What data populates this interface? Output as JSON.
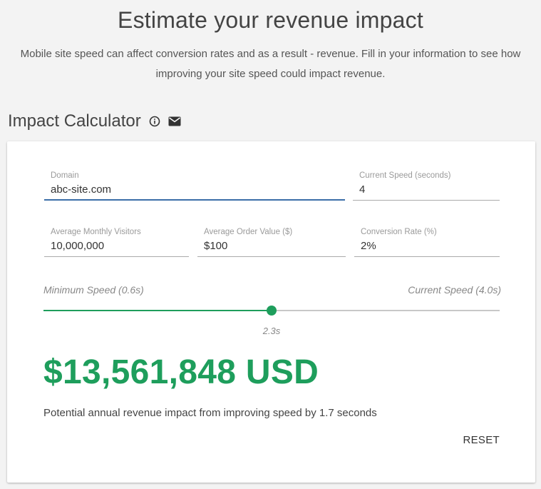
{
  "hero": {
    "title": "Estimate your revenue impact",
    "subtitle": "Mobile site speed can affect conversion rates and as a result - revenue. Fill in your information to see how improving your site speed could impact revenue."
  },
  "section": {
    "title": "Impact Calculator",
    "info_icon": "info-circle-icon",
    "email_icon": "envelope-icon"
  },
  "form": {
    "domain": {
      "label": "Domain",
      "value": "abc-site.com"
    },
    "current_speed": {
      "label": "Current Speed (seconds)",
      "value": "4"
    },
    "monthly_visitors": {
      "label": "Average Monthly Visitors",
      "value": "10,000,000"
    },
    "order_value": {
      "label": "Average Order Value ($)",
      "value": "$100"
    },
    "conversion_rate": {
      "label": "Conversion Rate (%)",
      "value": "2%"
    }
  },
  "slider": {
    "min_label": "Minimum Speed (0.6s)",
    "max_label": "Current Speed (4.0s)",
    "min": 0.6,
    "max": 4.0,
    "value": 2.3,
    "value_label": "2.3s",
    "color": "#1e9e5c"
  },
  "result": {
    "amount": "$13,561,848 USD",
    "caption": "Potential annual revenue impact from improving speed by 1.7 seconds"
  },
  "actions": {
    "reset_label": "RESET"
  }
}
